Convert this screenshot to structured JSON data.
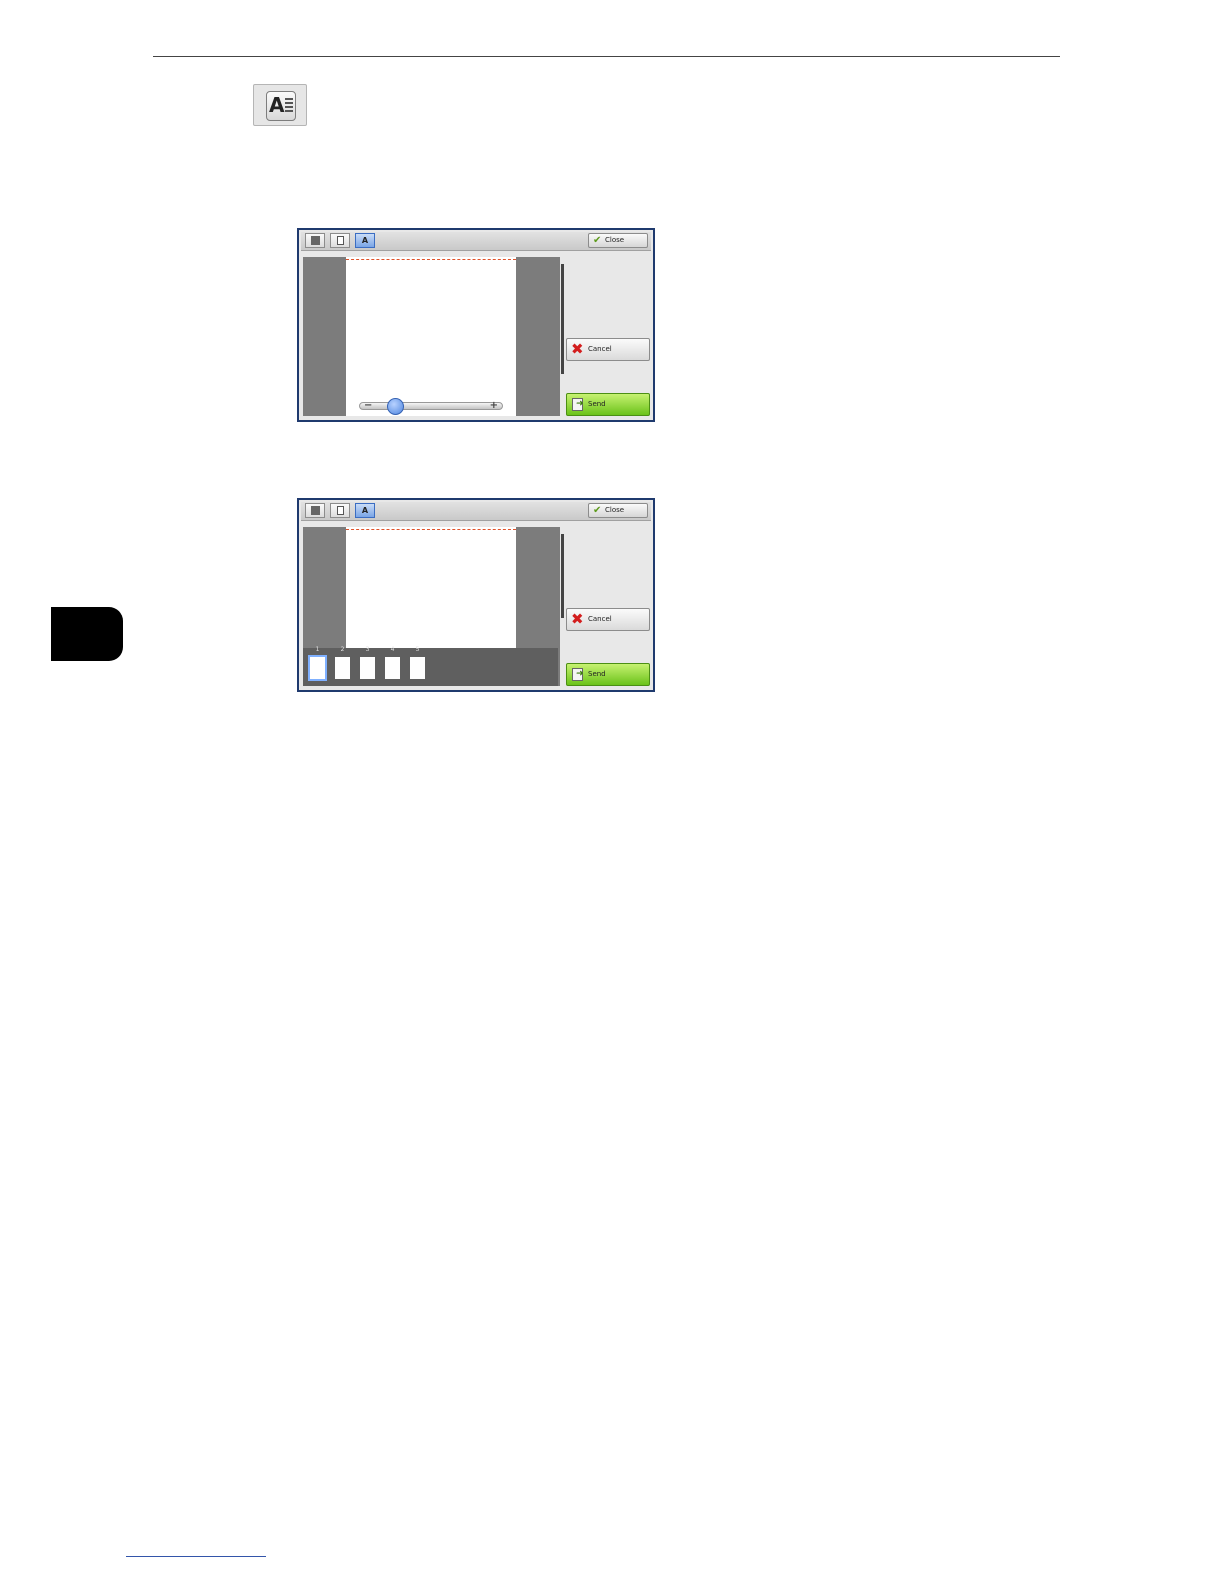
{
  "reference_icon": {
    "glyph": "A",
    "name": "page-view-icon"
  },
  "panels": [
    {
      "variant": "zoom",
      "toolbar": {
        "b1": "",
        "b2": "",
        "b3": "A",
        "close": "Close"
      },
      "buttons": {
        "cancel": "Cancel",
        "send": "Send"
      },
      "zoom_level": 0.15
    },
    {
      "variant": "thumbnails",
      "toolbar": {
        "b1": "",
        "b2": "",
        "b3": "A",
        "close": "Close"
      },
      "buttons": {
        "cancel": "Cancel",
        "send": "Send"
      },
      "thumbnails": [
        "1",
        "2",
        "3",
        "4",
        "5"
      ],
      "selected_thumbnail": "1"
    }
  ],
  "colors": {
    "frame": "#1f3a6e",
    "send": "#6bc21a",
    "cancel_icon": "#d31d1d",
    "active_tab": "#7aa5e6"
  }
}
